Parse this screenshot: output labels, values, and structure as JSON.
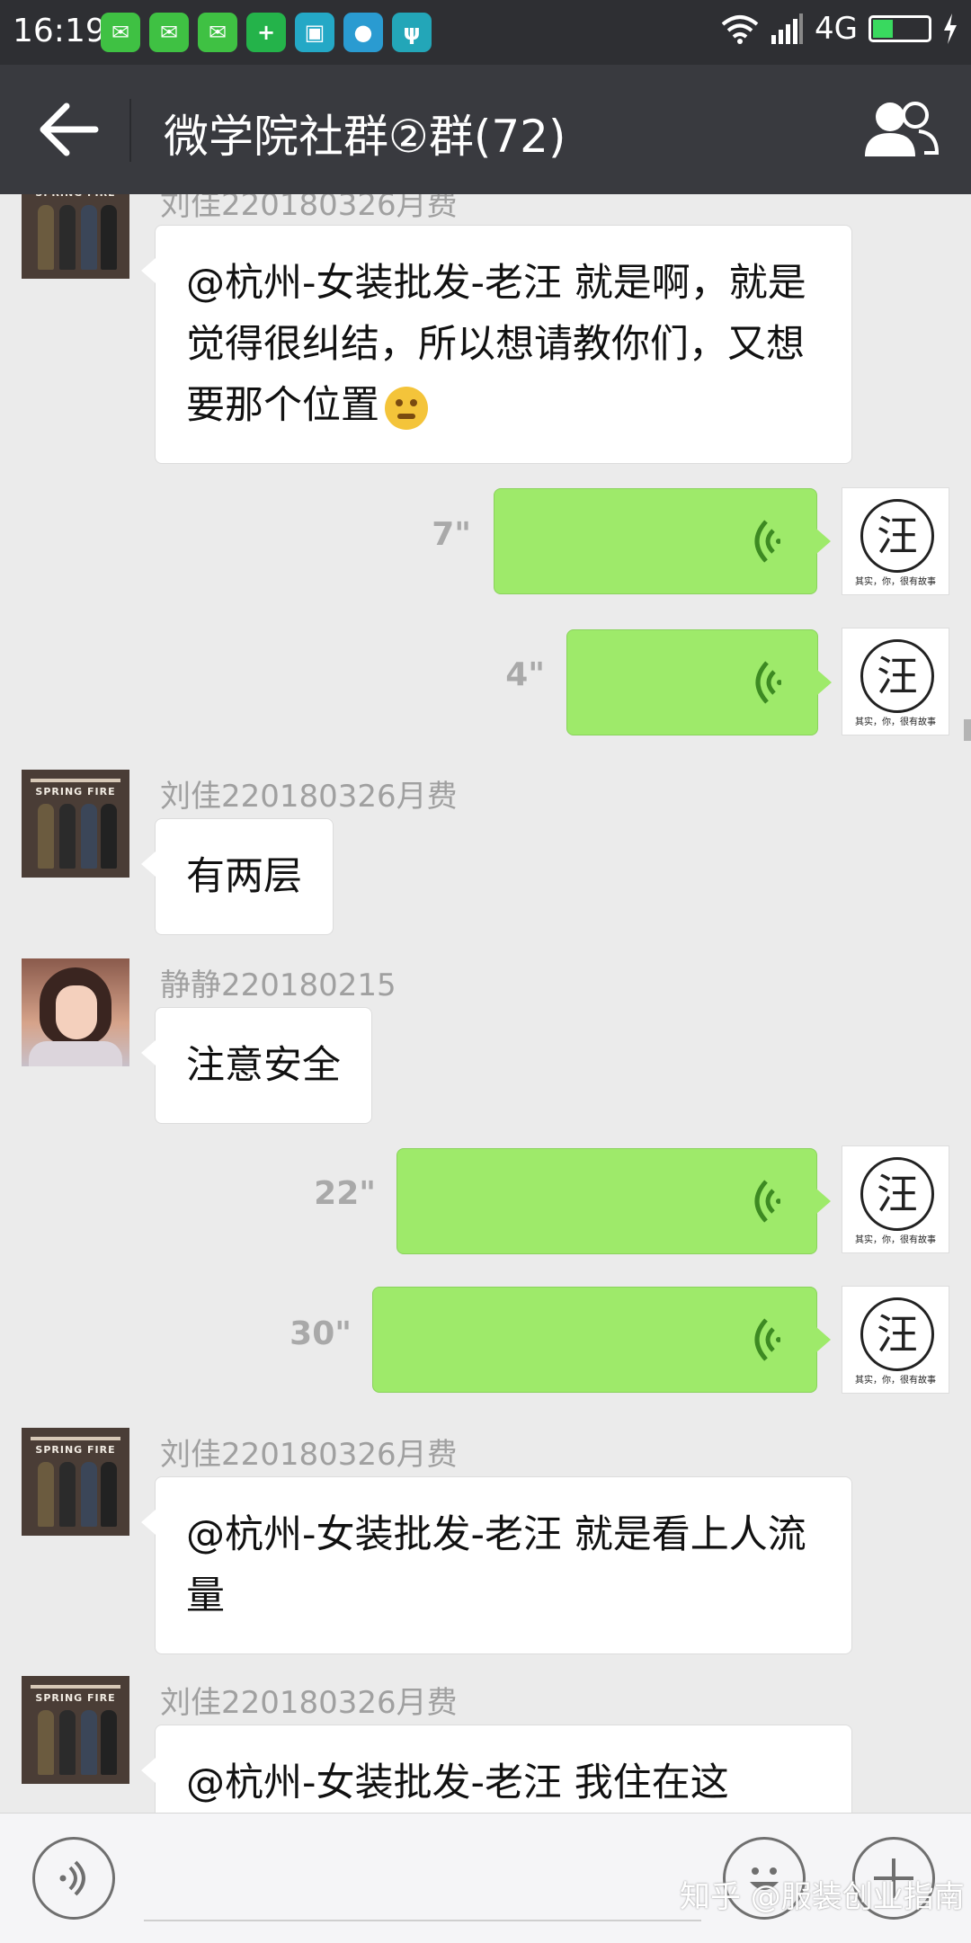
{
  "status_bar": {
    "time": "16:19",
    "network": "4G",
    "battery_level": 0.35,
    "notification_icons": [
      "wechat-icon",
      "wechat-icon",
      "wechat-icon",
      "add-app-icon",
      "scan-app-icon",
      "basketball-app-icon",
      "usb-icon"
    ]
  },
  "header": {
    "title": "微学院社群②群(72)"
  },
  "messages": [
    {
      "sender": "刘佳220180326月费",
      "text": "@杭州-女装批发-老汪  就是啊，就是觉得很纠结，所以想请教你们，又想要那个位置"
    },
    {
      "duration": "7\""
    },
    {
      "duration": "4\""
    },
    {
      "sender": "刘佳220180326月费",
      "text": "有两层"
    },
    {
      "sender": "静静220180215",
      "text": "注意安全"
    },
    {
      "duration": "22\""
    },
    {
      "duration": "30\""
    },
    {
      "sender": "刘佳220180326月费",
      "text": "@杭州-女装批发-老汪  就是看上人流量"
    },
    {
      "sender": "刘佳220180326月费",
      "text": "@杭州-女装批发-老汪  我住在这"
    }
  ],
  "avatars": {
    "store_label": "SPRING FIRE",
    "wang_char": "汪",
    "wang_tagline": "其实，你，很有故事"
  },
  "watermark": "知乎 @服装创业指南",
  "colors": {
    "header_bg": "#393a3f",
    "statusbar_bg": "#2e2f33",
    "chat_bg": "#ebebeb",
    "voice_bubble": "#9eea6a",
    "voice_wave": "#3d8a22"
  }
}
